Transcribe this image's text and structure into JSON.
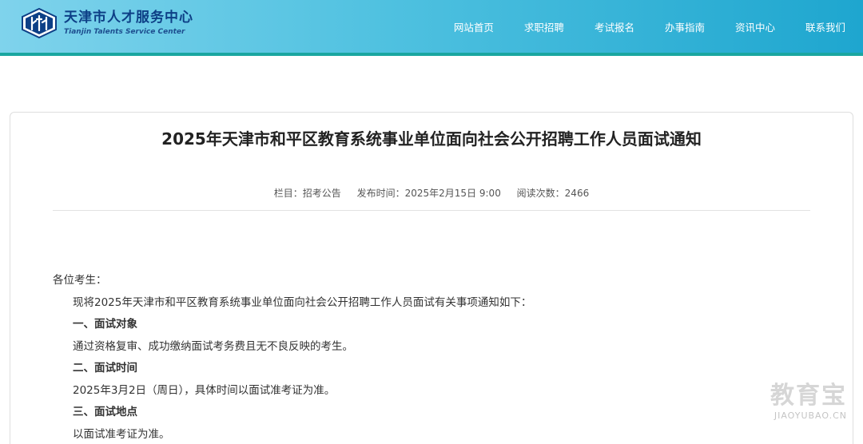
{
  "header": {
    "logo_title": "天津市人才服务中心",
    "logo_subtitle": "Tianjin Talents Service Center",
    "nav": [
      {
        "label": "网站首页"
      },
      {
        "label": "求职招聘"
      },
      {
        "label": "考试报名"
      },
      {
        "label": "办事指南"
      },
      {
        "label": "资讯中心"
      },
      {
        "label": "联系我们"
      }
    ]
  },
  "article": {
    "title": "2025年天津市和平区教育系统事业单位面向社会公开招聘工作人员面试通知",
    "meta": {
      "category": "栏目：招考公告",
      "publish_time": "发布时间：2025年2月15日 9:00",
      "views": "阅读次数：2466"
    },
    "body": {
      "greeting": "各位考生：",
      "intro": "现将2025年天津市和平区教育系统事业单位面向社会公开招聘工作人员面试有关事项通知如下：",
      "sec1_heading": "一、面试对象",
      "sec1_text": "通过资格复审、成功缴纳面试考务费且无不良反映的考生。",
      "sec2_heading": "二、面试时间",
      "sec2_text": "2025年3月2日（周日），具体时间以面试准考证为准。",
      "sec3_heading": "三、面试地点",
      "sec3_text": "以面试准考证为准。"
    }
  },
  "watermark": {
    "main": "教育宝",
    "sub": "JIAOYUBAO.CN"
  },
  "colors": {
    "header_start": "#7fd3ec",
    "header_end": "#1ea6cf",
    "header_border": "#1aa6a0",
    "logo_text": "#0d3f86"
  }
}
